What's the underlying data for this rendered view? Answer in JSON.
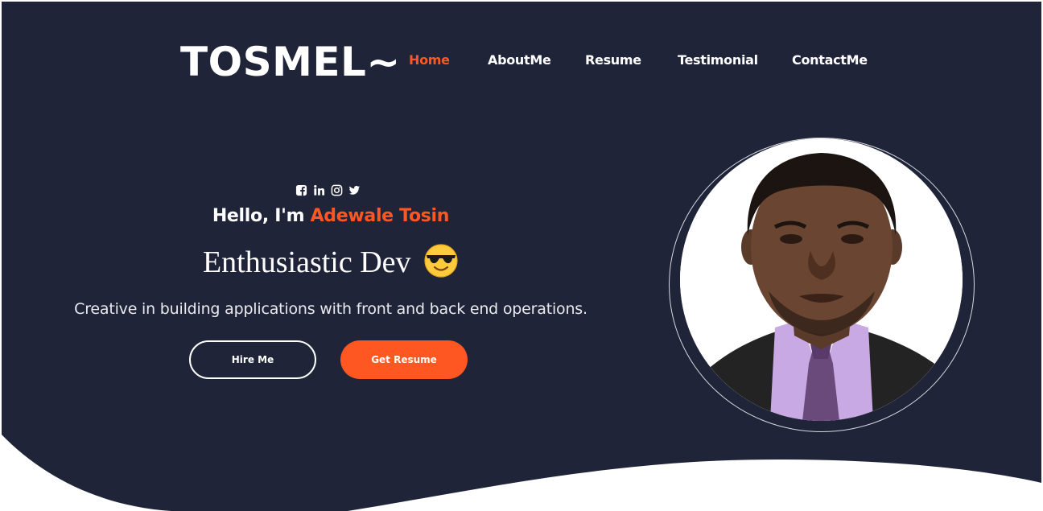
{
  "brand": {
    "logo": "TOSMEL~"
  },
  "nav": {
    "items": [
      {
        "label": "Home",
        "active": true
      },
      {
        "label": "AboutMe",
        "active": false
      },
      {
        "label": "Resume",
        "active": false
      },
      {
        "label": "Testimonial",
        "active": false
      },
      {
        "label": "ContactMe",
        "active": false
      }
    ]
  },
  "socials": [
    {
      "icon": "facebook-icon"
    },
    {
      "icon": "linkedin-icon"
    },
    {
      "icon": "instagram-icon"
    },
    {
      "icon": "twitter-icon"
    }
  ],
  "hero": {
    "greeting": "Hello, I'm",
    "name": "Adewale Tosin",
    "tagline": "Enthusiastic Dev",
    "tagline_emoji": "smiling-face-with-sunglasses",
    "description": "Creative in building applications with front and back end operations.",
    "hire_label": "Hire Me",
    "resume_label": "Get Resume"
  },
  "profile": {
    "photo": "profile-photo"
  },
  "colors": {
    "background": "#1f2439",
    "accent": "#ff5722",
    "text": "#ffffff",
    "page": "#ffffff"
  }
}
